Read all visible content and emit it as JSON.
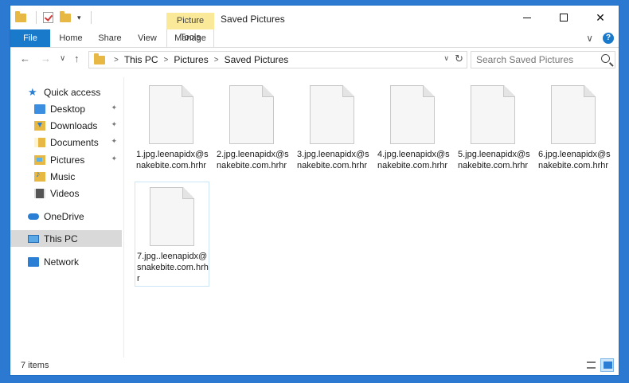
{
  "titlebar": {
    "context_tab": "Picture Tools",
    "title": "Saved Pictures",
    "qat_dropdown": "▾",
    "minimize": "",
    "maximize": "",
    "close": "✕"
  },
  "ribbon": {
    "tabs": [
      {
        "label": "File"
      },
      {
        "label": "Home"
      },
      {
        "label": "Share"
      },
      {
        "label": "View"
      },
      {
        "label": "Manage"
      }
    ],
    "collapse": "∨",
    "help": "?"
  },
  "nav": {
    "back": "←",
    "forward": "→",
    "recent": "∨",
    "up": "↑",
    "breadcrumb": [
      "This PC",
      "Pictures",
      "Saved Pictures"
    ],
    "separator": ">",
    "address_dropdown": "∨",
    "refresh": "↻",
    "search_placeholder": "Search Saved Pictures"
  },
  "sidebar": {
    "items": [
      {
        "label": "Quick access",
        "icon": "star-icon"
      },
      {
        "label": "Desktop",
        "icon": "desktop-icon",
        "pinned": true
      },
      {
        "label": "Downloads",
        "icon": "downloads-icon",
        "pinned": true
      },
      {
        "label": "Documents",
        "icon": "documents-icon",
        "pinned": true
      },
      {
        "label": "Pictures",
        "icon": "pictures-icon",
        "pinned": true
      },
      {
        "label": "Music",
        "icon": "music-icon"
      },
      {
        "label": "Videos",
        "icon": "videos-icon"
      },
      {
        "label": "OneDrive",
        "icon": "cloud-icon"
      },
      {
        "label": "This PC",
        "icon": "computer-icon",
        "selected": true
      },
      {
        "label": "Network",
        "icon": "network-icon"
      }
    ],
    "pin_glyph": "✦"
  },
  "files": [
    {
      "name": "1.jpg.leenapidx@snakebite.com.hrhr"
    },
    {
      "name": "2.jpg.leenapidx@snakebite.com.hrhr"
    },
    {
      "name": "3.jpg.leenapidx@snakebite.com.hrhr"
    },
    {
      "name": "4.jpg.leenapidx@snakebite.com.hrhr"
    },
    {
      "name": "5.jpg.leenapidx@snakebite.com.hrhr"
    },
    {
      "name": "6.jpg.leenapidx@snakebite.com.hrhr"
    },
    {
      "name": "7.jpg..leenapidx@snakebite.com.hrhr"
    }
  ],
  "status": {
    "item_count": "7 items"
  },
  "colors": {
    "accent": "#1979ca",
    "context_tab": "#fbe99a",
    "selected_nav": "#d9d9d9"
  }
}
